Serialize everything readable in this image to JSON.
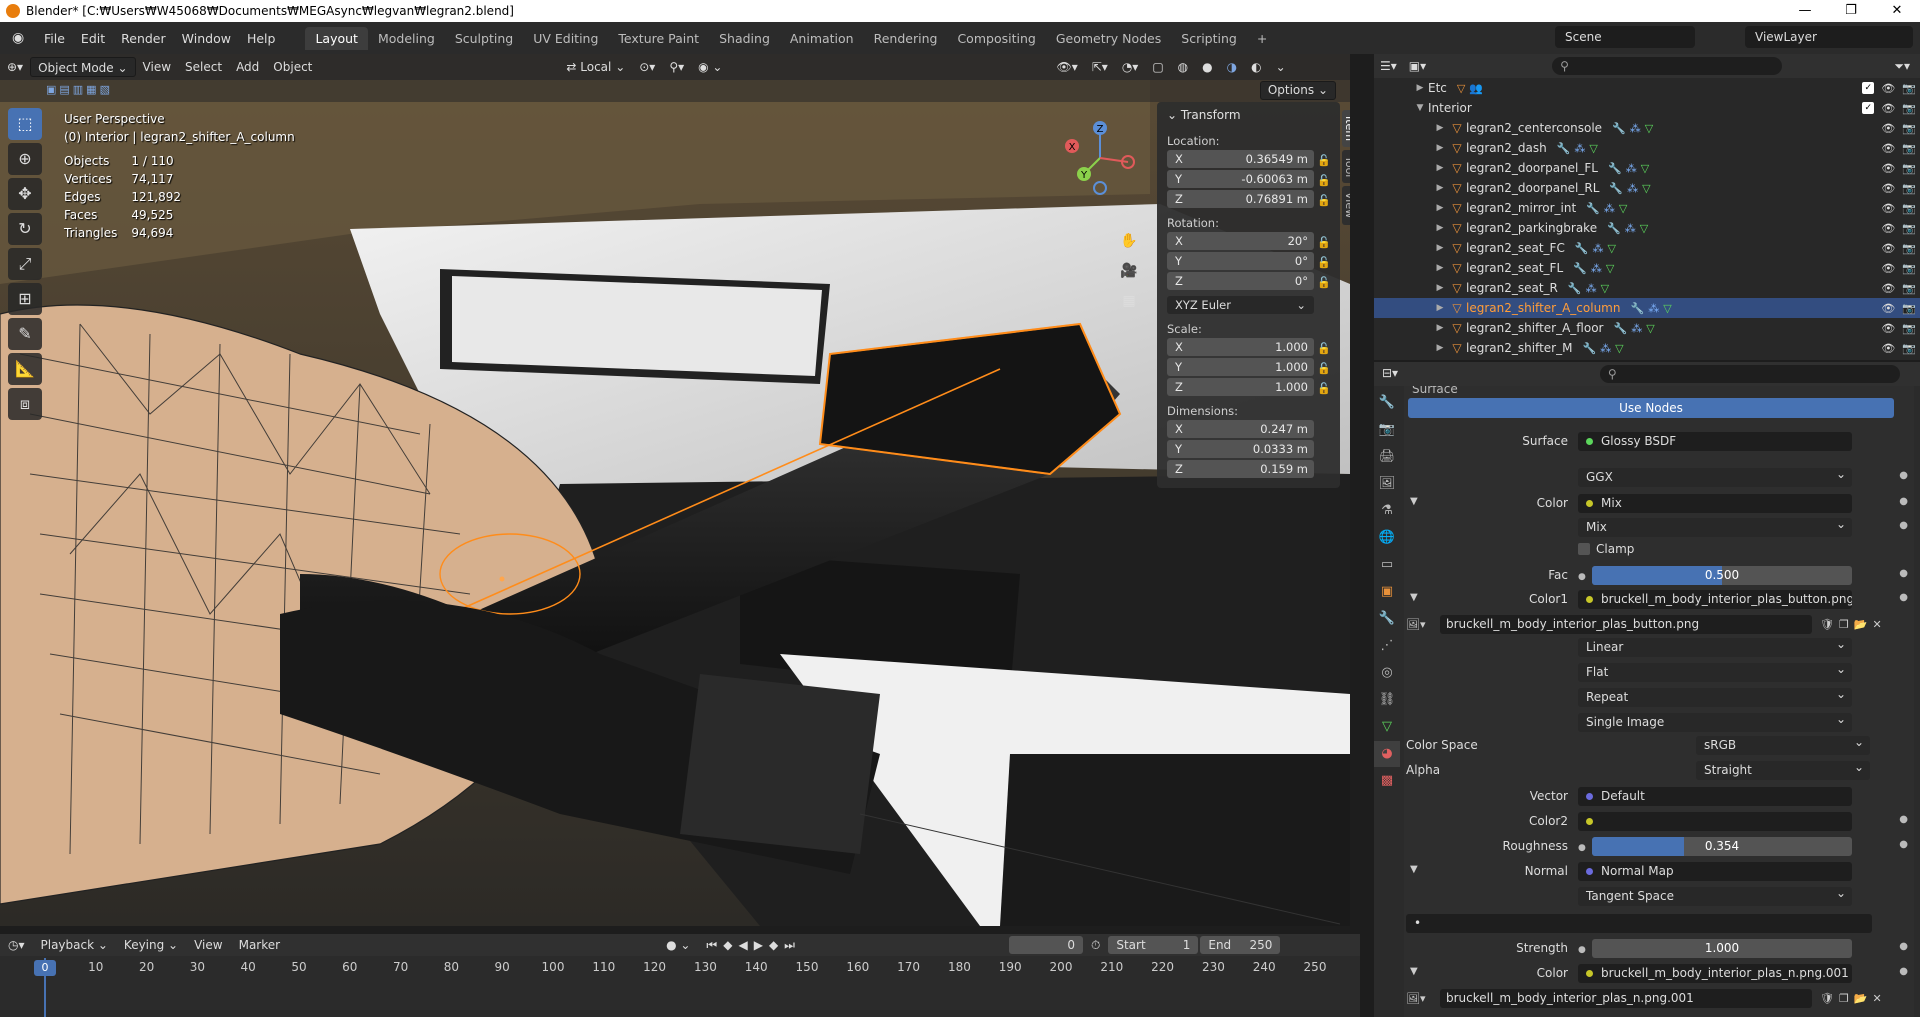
{
  "window": {
    "title": "Blender* [C:₩Users₩W45068₩Documents₩MEGAsync₩legvan₩legran2.blend]"
  },
  "menu": [
    "File",
    "Edit",
    "Render",
    "Window",
    "Help"
  ],
  "workspaces": [
    "Layout",
    "Modeling",
    "Sculpting",
    "UV Editing",
    "Texture Paint",
    "Shading",
    "Animation",
    "Rendering",
    "Compositing",
    "Geometry Nodes",
    "Scripting"
  ],
  "scene": {
    "scene": "Scene",
    "view_layer": "ViewLayer"
  },
  "viewport": {
    "mode": "Object Mode",
    "menus": [
      "View",
      "Select",
      "Add",
      "Object"
    ],
    "orientation": "Local",
    "options": "Options",
    "perspective": "User Perspective",
    "active_object": "(0) Interior | legran2_shifter_A_column",
    "stats": [
      {
        "label": "Objects",
        "value": "1 / 110"
      },
      {
        "label": "Vertices",
        "value": "74,117"
      },
      {
        "label": "Edges",
        "value": "121,892"
      },
      {
        "label": "Faces",
        "value": "49,525"
      },
      {
        "label": "Triangles",
        "value": "94,694"
      }
    ],
    "gizmo": {
      "x": "X",
      "y": "Y",
      "z": "Z"
    }
  },
  "npanel": {
    "title": "Transform",
    "location_label": "Location:",
    "location": [
      {
        "axis": "X",
        "value": "0.36549 m"
      },
      {
        "axis": "Y",
        "value": "-0.60063 m"
      },
      {
        "axis": "Z",
        "value": "0.76891 m"
      }
    ],
    "rotation_label": "Rotation:",
    "rotation": [
      {
        "axis": "X",
        "value": "20°"
      },
      {
        "axis": "Y",
        "value": "0°"
      },
      {
        "axis": "Z",
        "value": "0°"
      }
    ],
    "rotation_mode": "XYZ Euler",
    "scale_label": "Scale:",
    "scale": [
      {
        "axis": "X",
        "value": "1.000"
      },
      {
        "axis": "Y",
        "value": "1.000"
      },
      {
        "axis": "Z",
        "value": "1.000"
      }
    ],
    "dimensions_label": "Dimensions:",
    "dimensions": [
      {
        "axis": "X",
        "value": "0.247 m"
      },
      {
        "axis": "Y",
        "value": "0.0333 m"
      },
      {
        "axis": "Z",
        "value": "0.159 m"
      }
    ],
    "tabs": [
      "Item",
      "Tool",
      "View"
    ]
  },
  "timeline": {
    "menus": [
      "Playback",
      "Keying",
      "View",
      "Marker"
    ],
    "current_frame": "0",
    "start_label": "Start",
    "start": "1",
    "end_label": "End",
    "end": "250",
    "ticks": [
      "0",
      "10",
      "20",
      "30",
      "40",
      "50",
      "60",
      "70",
      "80",
      "90",
      "100",
      "110",
      "120",
      "130",
      "140",
      "150",
      "160",
      "170",
      "180",
      "190",
      "200",
      "210",
      "220",
      "230",
      "240",
      "250"
    ]
  },
  "outliner": {
    "rows": [
      {
        "name": "Etc",
        "level": 2,
        "collection": true
      },
      {
        "name": "Interior",
        "level": 1,
        "collection": true
      },
      {
        "name": "legran2_centerconsole",
        "level": 3
      },
      {
        "name": "legran2_dash",
        "level": 3
      },
      {
        "name": "legran2_doorpanel_FL",
        "level": 3
      },
      {
        "name": "legran2_doorpanel_RL",
        "level": 3
      },
      {
        "name": "legran2_mirror_int",
        "level": 3
      },
      {
        "name": "legran2_parkingbrake",
        "level": 3
      },
      {
        "name": "legran2_seat_FC",
        "level": 3
      },
      {
        "name": "legran2_seat_FL",
        "level": 3
      },
      {
        "name": "legran2_seat_R",
        "level": 3
      },
      {
        "name": "legran2_shifter_A_column",
        "level": 3,
        "selected": true
      },
      {
        "name": "legran2_shifter_A_floor",
        "level": 3
      },
      {
        "name": "legran2_shifter_M",
        "level": 3
      }
    ]
  },
  "properties": {
    "section": "Surface",
    "use_nodes": "Use Nodes",
    "surface_label": "Surface",
    "surface": "Glossy BSDF",
    "distribution": "GGX",
    "color_label": "Color",
    "color": "Mix",
    "blend_type": "Mix",
    "clamp": "Clamp",
    "fac_label": "Fac",
    "fac": "0.500",
    "fac_fraction": 0.5,
    "color1_label": "Color1",
    "color1": "bruckell_m_body_interior_plas_button.png",
    "image_name": "bruckell_m_body_interior_plas_button.png",
    "interpolation": "Linear",
    "projection": "Flat",
    "extension": "Repeat",
    "source": "Single Image",
    "color_space_label": "Color Space",
    "color_space": "sRGB",
    "alpha_label": "Alpha",
    "alpha": "Straight",
    "vector_label": "Vector",
    "vector": "Default",
    "color2_label": "Color2",
    "roughness_label": "Roughness",
    "roughness": "0.354",
    "roughness_fraction": 0.354,
    "normal_label": "Normal",
    "normal": "Normal Map",
    "tangent": "Tangent Space",
    "strength_label": "Strength",
    "strength": "1.000",
    "color3_label": "Color",
    "color3": "bruckell_m_body_interior_plas_n.png.001",
    "image2_name": "bruckell_m_body_interior_plas_n.png.001"
  }
}
